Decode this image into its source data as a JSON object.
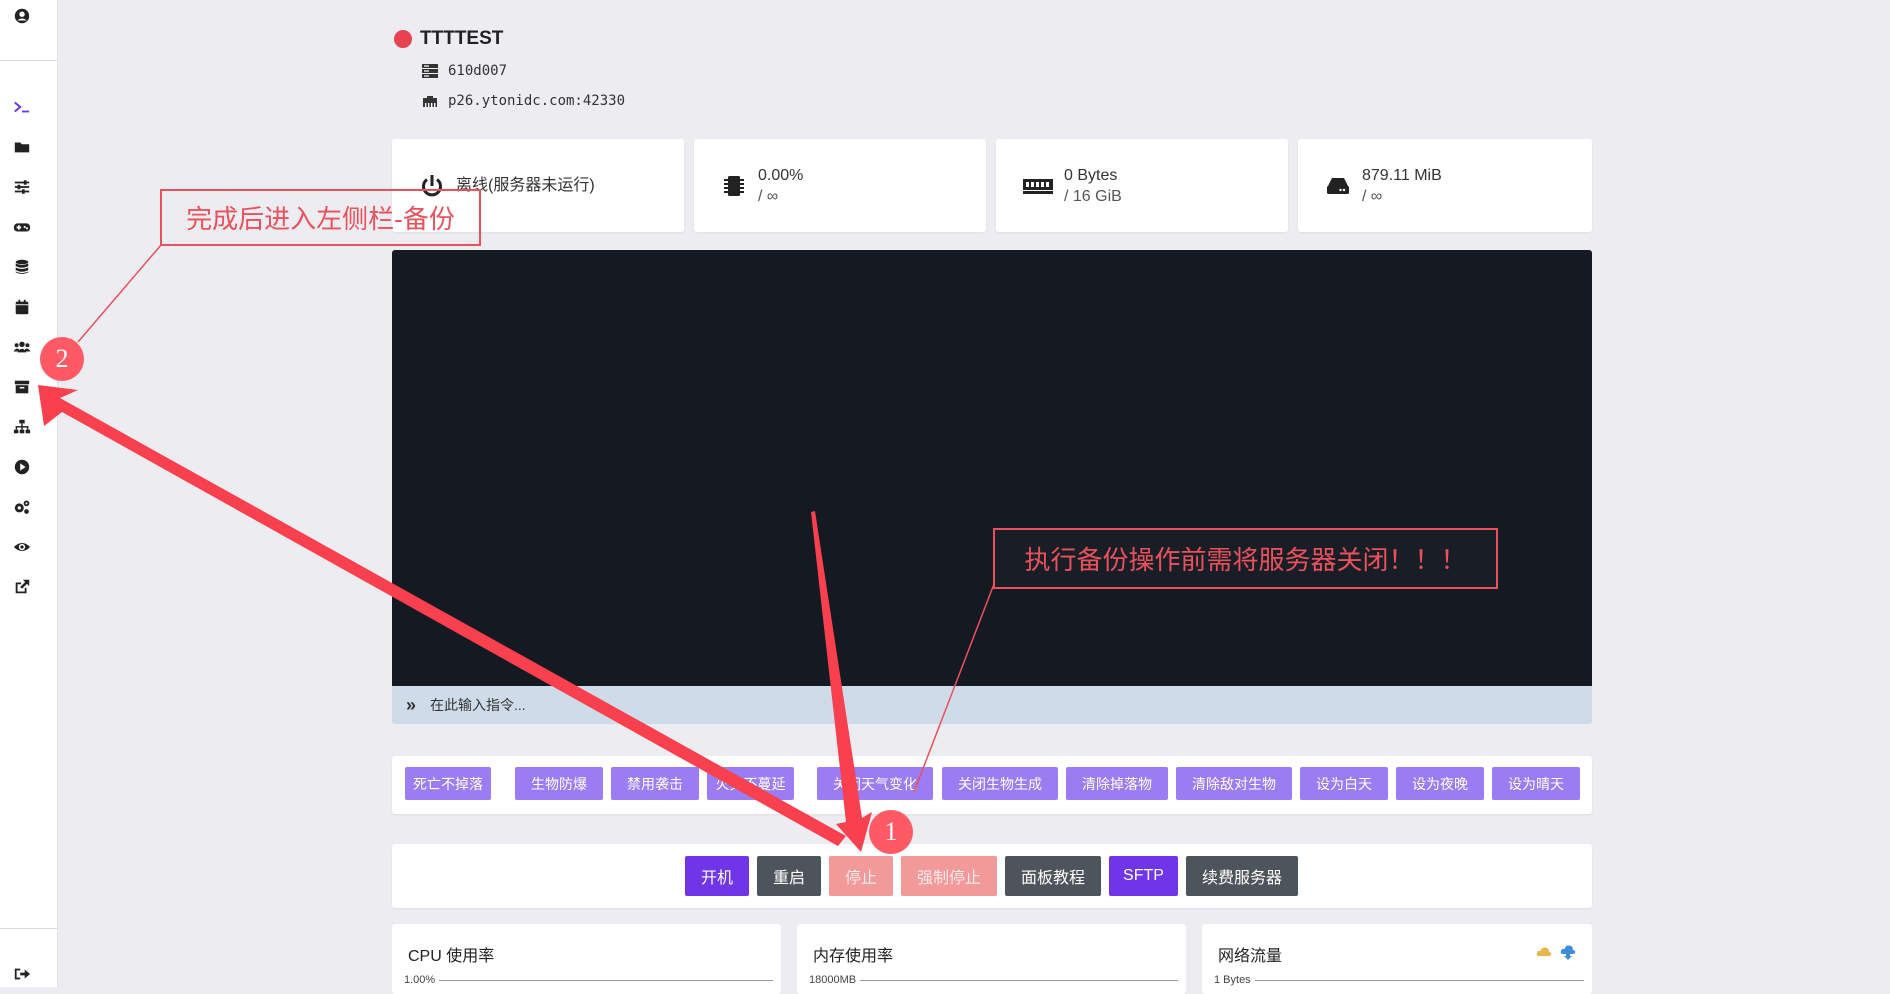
{
  "sidebar": {
    "top_icon": "user-circle-icon",
    "items": [
      {
        "icon": "terminal-icon",
        "active": true
      },
      {
        "icon": "folder-icon"
      },
      {
        "icon": "sliders-icon"
      },
      {
        "icon": "gamepad-icon"
      },
      {
        "icon": "database-icon"
      },
      {
        "icon": "calendar-icon"
      },
      {
        "icon": "users-icon"
      },
      {
        "icon": "archive-icon"
      },
      {
        "icon": "network-icon"
      },
      {
        "icon": "play-circle-icon"
      },
      {
        "icon": "cogs-icon"
      },
      {
        "icon": "eye-icon"
      },
      {
        "icon": "external-link-icon"
      }
    ],
    "bottom_icon": "sign-out-icon",
    "accent_color": "#6f35e6"
  },
  "server": {
    "name": "TTTTEST",
    "status_color": "#e84150",
    "id": "610d007",
    "address": "p26.ytonidc.com:42330"
  },
  "cards": [
    {
      "icon": "power-icon",
      "line1": "离线(服务器未运行)",
      "line2": ""
    },
    {
      "icon": "cpu-icon",
      "line1": "0.00%",
      "line2": "/ ∞"
    },
    {
      "icon": "memory-icon",
      "line1": "0 Bytes",
      "line2": "/ 16 GiB"
    },
    {
      "icon": "hdd-icon",
      "line1": "879.11 MiB",
      "line2": "/ ∞"
    }
  ],
  "console": {
    "placeholder": "在此输入指令..."
  },
  "commands": [
    "死亡不掉落",
    "生物防爆",
    "禁用袭击",
    "火势不蔓延",
    "关闭天气变化",
    "关闭生物生成",
    "清除掉落物",
    "清除敌对生物",
    "设为白天",
    "设为夜晚",
    "设为晴天"
  ],
  "power_buttons": [
    {
      "label": "开机",
      "style": "purple"
    },
    {
      "label": "重启",
      "style": "dark"
    },
    {
      "label": "停止",
      "style": "pink"
    },
    {
      "label": "强制停止",
      "style": "pink"
    },
    {
      "label": "面板教程",
      "style": "dark"
    },
    {
      "label": "SFTP",
      "style": "purple"
    },
    {
      "label": "续费服务器",
      "style": "dark"
    }
  ],
  "stats": [
    {
      "title": "CPU 使用率",
      "axis_label": "1.00%"
    },
    {
      "title": "内存使用率",
      "axis_label": "18000MB"
    },
    {
      "title": "网络流量",
      "axis_label": "1 Bytes"
    }
  ],
  "annotations": {
    "callout_left": "完成后进入左侧栏-备份",
    "callout_right": "执行备份操作前需将服务器关闭！！！",
    "badge_1": "1",
    "badge_2": "2",
    "color": "#e9515c"
  }
}
